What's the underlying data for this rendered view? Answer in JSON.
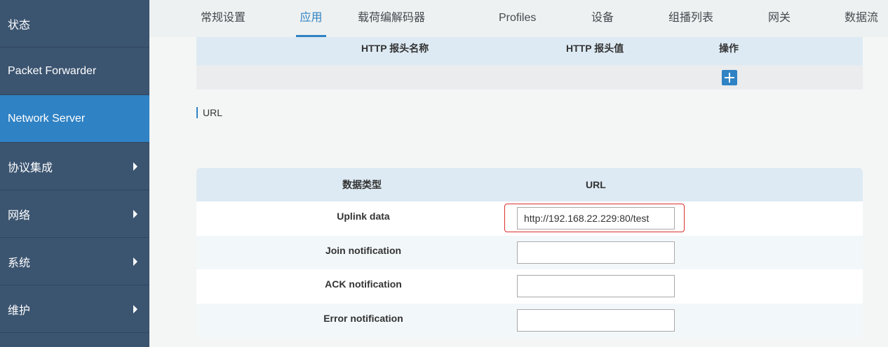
{
  "sidebar": {
    "items": [
      {
        "label": "状态"
      },
      {
        "label": "Packet Forwarder"
      },
      {
        "label": "Network Server"
      },
      {
        "label": "协议集成"
      },
      {
        "label": "网络"
      },
      {
        "label": "系统"
      },
      {
        "label": "维护"
      }
    ]
  },
  "tabs": [
    {
      "label": "常规设置"
    },
    {
      "label": "应用"
    },
    {
      "label": "载荷编解码器"
    },
    {
      "label": "Profiles"
    },
    {
      "label": "设备"
    },
    {
      "label": "组播列表"
    },
    {
      "label": "网关"
    },
    {
      "label": "数据流"
    }
  ],
  "header_table": {
    "col_name": "HTTP 报头名称",
    "col_value": "HTTP 报头值",
    "col_action": "操作"
  },
  "url_section": {
    "title": "URL",
    "col_type": "数据类型",
    "col_url": "URL",
    "rows": [
      {
        "name": "Uplink data",
        "value": "http://192.168.22.229:80/test"
      },
      {
        "name": "Join notification",
        "value": ""
      },
      {
        "name": "ACK notification",
        "value": ""
      },
      {
        "name": "Error notification",
        "value": ""
      }
    ]
  },
  "colors": {
    "accent": "#2f82c4",
    "sidebar": "#3b5470",
    "highlight": "#d9302c"
  }
}
